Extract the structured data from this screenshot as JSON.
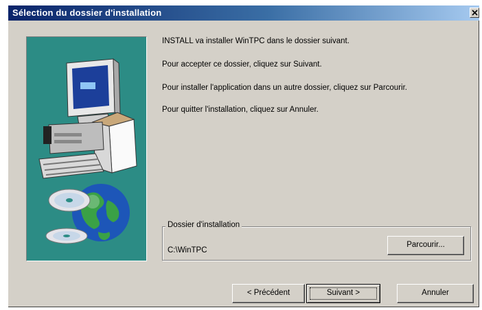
{
  "window": {
    "title": "Sélection du dossier d'installation"
  },
  "messages": [
    "INSTALL va installer WinTPC dans le dossier suivant.",
    "Pour accepter ce dossier, cliquez sur Suivant.",
    "Pour installer l'application dans un autre dossier, cliquez sur Parcourir.",
    "Pour quitter l'installation, cliquez sur Annuler."
  ],
  "install_folder": {
    "label": "Dossier d'installation",
    "path": "C:\\WinTPC",
    "browse_label": "Parcourir..."
  },
  "buttons": {
    "previous": "< Précédent",
    "next": "Suivant >",
    "cancel": "Annuler"
  },
  "icons": {
    "close": "close-icon",
    "artwork": "computer-cd-globe-illustration"
  },
  "colors": {
    "titlebar_start": "#0a246a",
    "titlebar_end": "#a6caf0",
    "dialog_bg": "#d4d0c8",
    "art_bg": "#2c8c85"
  }
}
